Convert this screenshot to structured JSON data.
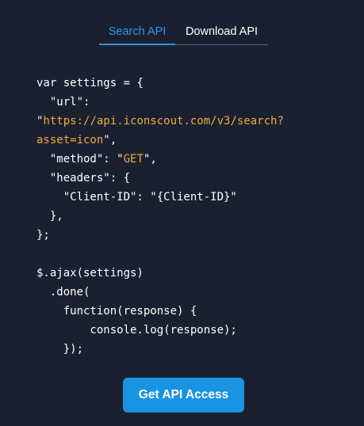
{
  "tabs": [
    {
      "label": "Search API",
      "active": true
    },
    {
      "label": "Download API",
      "active": false
    }
  ],
  "code": {
    "l1": "var settings = {",
    "l2_indent": "  ",
    "l2_key": "\"url\":",
    "l3_q": "\"",
    "l3_url": "https://api.iconscout.com/v3/search?",
    "l4_url": "asset=icon",
    "l4_q": "\",",
    "l5_key": "  \"method\": ",
    "l5_q1": "\"",
    "l5_val": "GET",
    "l5_q2": "\",",
    "l6": "  \"headers\": {",
    "l7": "    \"Client-ID\": \"{Client-ID}\"",
    "l8": "  },",
    "l9": "};",
    "l11": "$.ajax(settings)",
    "l12": "  .done(",
    "l13": "    function(response) {",
    "l14": "        console.log(response);",
    "l15": "    });"
  },
  "cta": {
    "label": "Get API Access"
  },
  "colors": {
    "background": "#1a2030",
    "accent": "#2f97e6",
    "string": "#f2a93b",
    "button": "#1a93e2"
  }
}
